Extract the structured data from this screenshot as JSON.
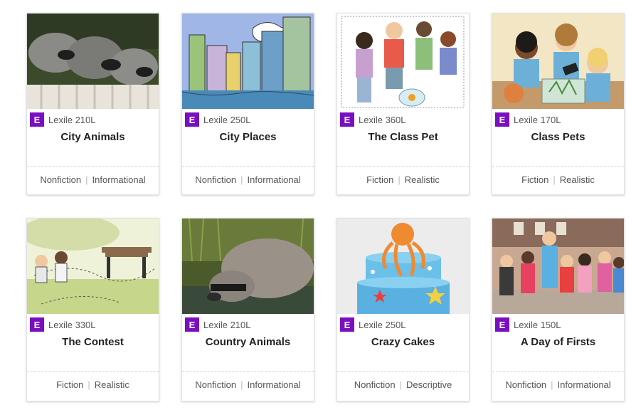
{
  "cards": [
    {
      "lexile": "Lexile 210L",
      "badge": "E",
      "title": "City Animals",
      "genre": "Nonfiction",
      "type": "Informational",
      "image": "raccoons-on-fence"
    },
    {
      "lexile": "Lexile 250L",
      "badge": "E",
      "title": "City Places",
      "genre": "Nonfiction",
      "type": "Informational",
      "image": "city-skyline-illustration"
    },
    {
      "lexile": "Lexile 360L",
      "badge": "E",
      "title": "The Class Pet",
      "genre": "Fiction",
      "type": "Realistic",
      "image": "kids-with-goldfish"
    },
    {
      "lexile": "Lexile 170L",
      "badge": "E",
      "title": "Class Pets",
      "genre": "Fiction",
      "type": "Realistic",
      "image": "kids-with-terrarium"
    },
    {
      "lexile": "Lexile 330L",
      "badge": "E",
      "title": "The Contest",
      "genre": "Fiction",
      "type": "Realistic",
      "image": "kids-in-park-map"
    },
    {
      "lexile": "Lexile 210L",
      "badge": "E",
      "title": "Country Animals",
      "genre": "Nonfiction",
      "type": "Informational",
      "image": "raccoon-drinking"
    },
    {
      "lexile": "Lexile 250L",
      "badge": "E",
      "title": "Crazy Cakes",
      "genre": "Nonfiction",
      "type": "Descriptive",
      "image": "octopus-cake"
    },
    {
      "lexile": "Lexile 150L",
      "badge": "E",
      "title": "A Day of Firsts",
      "genre": "Nonfiction",
      "type": "Informational",
      "image": "schoolchildren-outdoors"
    }
  ],
  "colors": {
    "badge": "#7a0fbf",
    "text": "#222222",
    "tag": "#555555"
  },
  "separator": "|"
}
